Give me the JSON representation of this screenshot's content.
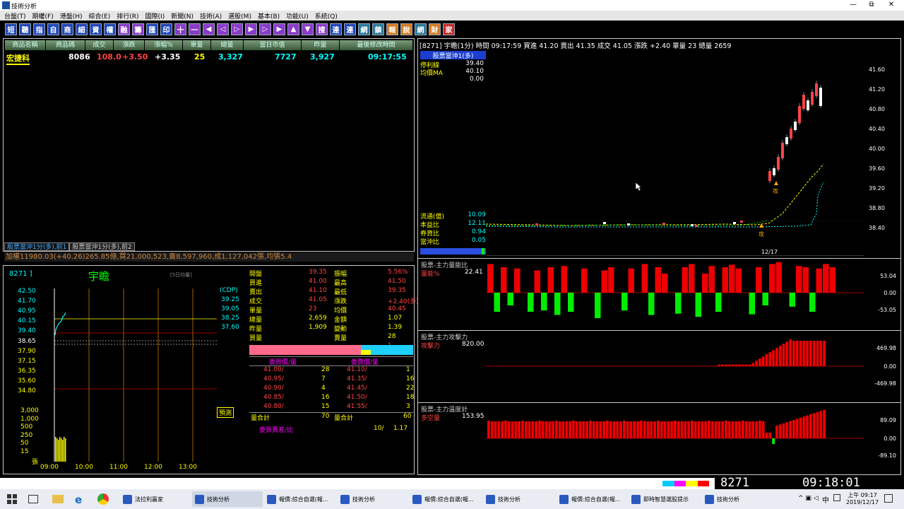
{
  "window": {
    "title": "技術分析",
    "controls": [
      "—",
      "⧉",
      "✕"
    ]
  },
  "menu": [
    "台盤(T)",
    "期權(F)",
    "港盤(H)",
    "綜合(E)",
    "排行(R)",
    "國際(I)",
    "新聞(N)",
    "技術(A)",
    "選股(M)",
    "基本(B)",
    "功能(U)",
    "系統(Q)"
  ],
  "toolbar": [
    "短",
    "聽",
    "指",
    "自",
    "商",
    "細",
    "資",
    "權",
    "融",
    "籌",
    "匯",
    "印",
    "十",
    "一",
    "◀",
    "◁",
    "▷",
    "▶",
    "▷",
    "▶",
    "▲",
    "▼",
    "搜",
    "連",
    "連",
    "網",
    "鎖",
    "報",
    "說",
    "網",
    "財",
    "家"
  ],
  "quote_headers": [
    "商品名稱",
    "商品碼",
    "成交",
    "漲跌",
    "漲幅%",
    "單量",
    "總量",
    "當日市值",
    "昨量",
    "最後修改時間"
  ],
  "quote_row": {
    "name": "宏捷科",
    "code": "8086",
    "price": "108.0",
    "change": "+3.50",
    "pct": "+3.35",
    "vol": "25",
    "total": "3,327",
    "mv": "7727",
    "yvol": "3,927",
    "time": "09:17:55"
  },
  "tabs": [
    "股票當沖1分(多),前1",
    "股票當沖1分(多),前2"
  ],
  "ticker": "加權11980.03(+40.26)265.85億,買21,000,523,賣8,597,960,成1,127,042張,均張5.4",
  "detail": {
    "code": "8271 ]",
    "name": "宇瞻",
    "tag": "[5日均量]",
    "cdp": "(CDP)",
    "cdp_values": [
      "39.25",
      "39.05",
      "38.25",
      "37.60"
    ],
    "price_axis": [
      "42.50",
      "41.70",
      "40.95",
      "40.15",
      "39.40",
      "38.65",
      "37.90",
      "37.15",
      "36.35",
      "35.60",
      "34.80"
    ],
    "vol_axis": [
      "3,000",
      "1,000",
      "500",
      "250",
      "50",
      "15",
      "張"
    ],
    "time_axis": [
      "09:00",
      "10:00",
      "11:00",
      "12:00",
      "13:00"
    ],
    "pred": "預測",
    "stats": [
      [
        "開盤",
        "39.35",
        "振幅",
        "5.56%"
      ],
      [
        "買進",
        "41.00",
        "最高",
        "41.50"
      ],
      [
        "賣出",
        "41.10",
        "最低",
        "39.35"
      ],
      [
        "成交",
        "41.05",
        "漲跌",
        "+2.40(多)"
      ],
      [
        "單量",
        "23",
        "均價",
        "40.45"
      ],
      [
        "總量",
        "2,659",
        "金額",
        "1.07"
      ],
      [
        "昨量",
        "1,909",
        "變動",
        "1.39"
      ],
      [
        "買量",
        "",
        "賣量",
        "28"
      ],
      [
        "",
        "",
        "",
        "1"
      ]
    ],
    "book_hdr": [
      "委買價/量",
      "委賣價/量"
    ],
    "bids": [
      [
        "41.00/",
        "28"
      ],
      [
        "40.95/",
        "7"
      ],
      [
        "40.90/",
        "4"
      ],
      [
        "40.85/",
        "16"
      ],
      [
        "40.80/",
        "15"
      ]
    ],
    "asks": [
      [
        "41.10/",
        "1"
      ],
      [
        "41.35/",
        "16"
      ],
      [
        "41.45/",
        "22"
      ],
      [
        "41.50/",
        "18"
      ],
      [
        "41.55/",
        "3"
      ]
    ],
    "bid_total": [
      "量合計",
      "70"
    ],
    "ask_total": [
      "量合計",
      "60"
    ],
    "spread": [
      "委買賣差/比",
      "10/",
      "1.17"
    ]
  },
  "chart": {
    "header": "[8271] 宇瞻(1分) 時間 09:17:59  買進 41.20  賣出 41.35  成交 41.05  漲跌 +2.40  單量 23  總量 2659",
    "legend_title": "股票當沖1(多)",
    "legend": [
      [
        "停利線",
        "39.40"
      ],
      [
        "均價MA",
        "40.10"
      ],
      [
        "",
        "0.00"
      ]
    ],
    "stats": [
      [
        "流通(億)",
        "10.09"
      ],
      [
        "本益比",
        "12.11"
      ],
      [
        "券資比",
        "0.94"
      ],
      [
        "當沖比",
        "0.05"
      ]
    ],
    "yaxis": [
      "41.60",
      "41.20",
      "40.80",
      "40.40",
      "40.00",
      "39.60",
      "39.20",
      "38.80",
      "38.40"
    ],
    "date": "12/17",
    "attack": "攻",
    "sub1": {
      "title": "股票-主力量能比",
      "name": "量能%",
      "value": "22.41",
      "axis": [
        "53.04",
        "0.00",
        "-53.05"
      ]
    },
    "sub2": {
      "title": "股票-主力攻擊力",
      "name": "攻擊力",
      "value": "820.00",
      "axis": [
        "469.98",
        "0.00",
        "-469.98"
      ]
    },
    "sub3": {
      "title": "股票-主力溫度計",
      "name": "多空量",
      "value": "153.95",
      "axis": [
        "89.09",
        "0.00",
        "-89.10"
      ]
    }
  },
  "status": {
    "code": "8271",
    "time": "09:18:01"
  },
  "taskbar": {
    "tasks": [
      "法拉利贏家",
      "技術分析",
      "報價:綜合自選(報...",
      "技術分析",
      "報價:綜合自選(報...",
      "技術分析",
      "報價:綜合自選(報...",
      "即時智慧選股提示",
      "技術分析"
    ],
    "clock_time": "上午 09:17",
    "clock_date": "2019/12/17",
    "ime": "中"
  }
}
